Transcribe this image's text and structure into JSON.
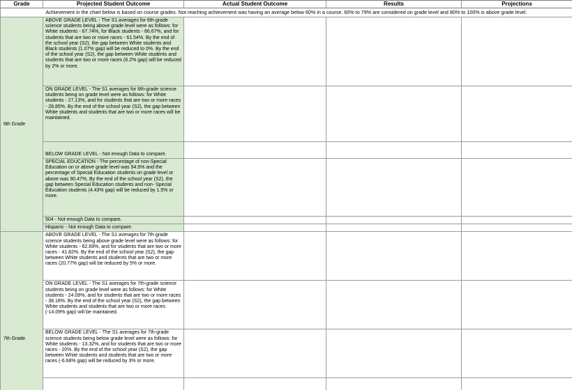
{
  "columns": {
    "grade": "Grade",
    "projected": "Projected Student Outcome",
    "actual": "Actual Student Outcome",
    "results": "Results",
    "projections": "Projections"
  },
  "note": "Achievement in the chart below is based on course grades. Not reaching achievement was having an average below 60% in a course. 60% to 79% are considered on grade level and 80% to 100% is above grade level.",
  "grades": [
    {
      "label": "6th Grade",
      "rows": [
        "ABOVE GRADE LEVEL - The S1 averages for 6th-grade science students being above grade level were as follows: for White students - 67.74%, for Black students - 66.67%, and for students that are two or more races - 61.54%. By the end of the school year (S2), the gap between White students and Black students (1.07% gap) will be reduced to 0%. By the end of the school year (S2), the gap between White students and students that are two or more races (6.2% gap) will be reduced by 2% or more.",
        "ON GRADE LEVEL - The S1 averages for 6th-grade science students being on grade level were as follows: for White students - 27.13%, and for students that are two or more races - 28.85%. By the end of the school year (S2), the gap between White students and students that are two or more races will be maintained.",
        "BELOW GRADE LEVEL - Not enough Data to compare.",
        "SPECIAL EDUCATION - The percentage of non-Special Education on or above grade level was 94.9% and the percentage of Special Education students on grade level or above was 90.47%. By the end of the school year (S2), the gap between Special Education students and non- Special Education students (4.43% gap) will be reduced by 1.5% or more.",
        "504 - Not enough Data to compare.",
        "Hispanic - Not enough Data to compare."
      ]
    },
    {
      "label": "7th Grade",
      "rows": [
        "ABOVE GRADE LEVEL - The S1 averages for 7th-grade science students being above grade level were as follows: for White students - 62.69%, and for students that are two or more races - 41.82%. By the end of the school year (S2), the gap between White students and students that are two or more races (20.77% gap) will be reduced by 5% or more.",
        "ON GRADE LEVEL - The S1 averages for 7th-grade science students being on grade level were as follows: for White students - 24.09%, and for students that are two or more races - 38.18%. By the end of the school year (S2), the gap between White students and students that are two or more races (-14.09% gap) will be maintained.",
        "BELOW GRADE LEVEL - The S1 averages for 7th-grade science students being below grade level were as follows: for White students - 13.32%, and for students that are two or more races - 20%. By the end of the school year (S2), the gap between White students and students that are two or more races (-6.68% gap) will be reduced by 3% or more.",
        ""
      ]
    }
  ]
}
